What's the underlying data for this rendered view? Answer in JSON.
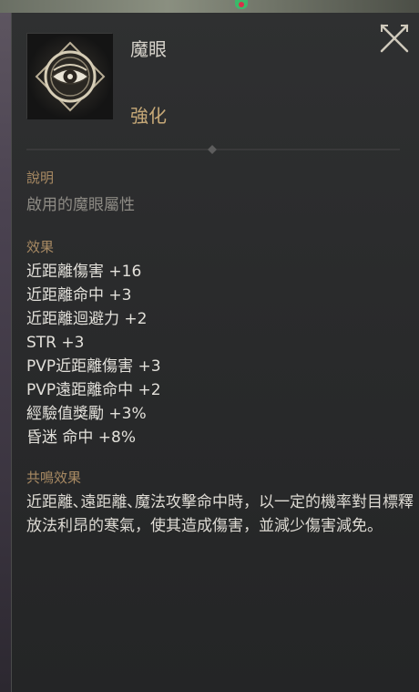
{
  "item": {
    "name": "魔眼",
    "grade": "強化",
    "icon": "eye-emblem-icon"
  },
  "description": {
    "heading": "說明",
    "text": "啟用的魔眼屬性"
  },
  "effects": {
    "heading": "效果",
    "lines": [
      "近距離傷害 +16",
      "近距離命中 +3",
      "近距離迴避力 +2",
      "STR +3",
      "PVP近距離傷害 +3",
      "PVP遠距離命中 +2",
      "經驗值獎勵 +3%",
      "昏迷 命中 +8%"
    ]
  },
  "resonance": {
    "heading": "共鳴效果",
    "text": "近距離､遠距離､魔法攻擊命中時，以一定的機率對目標釋放法利昂的寒氣，使其造成傷害，並減少傷害減免。"
  },
  "colors": {
    "panel_bg": "#2a2b2c",
    "heading": "#a88a63",
    "grade": "#c7a978",
    "text": "#e2e0da",
    "muted": "#8e8b85"
  }
}
